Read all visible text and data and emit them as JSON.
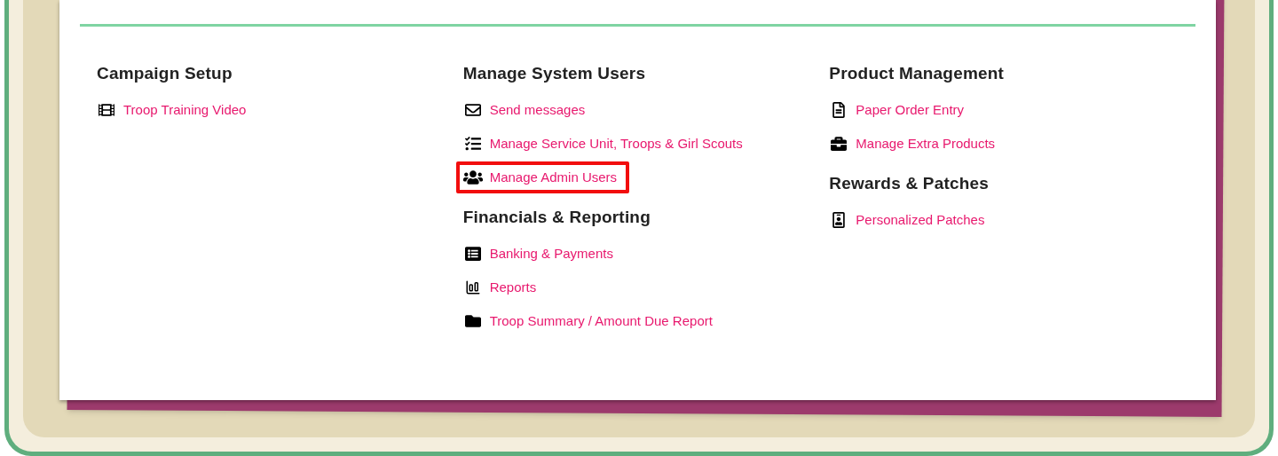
{
  "columns": [
    {
      "sections": [
        {
          "title": "Campaign Setup",
          "links": [
            {
              "label": "Troop Training Video",
              "highlighted": false
            }
          ]
        }
      ]
    },
    {
      "sections": [
        {
          "title": "Manage System Users",
          "links": [
            {
              "label": "Send messages",
              "highlighted": false
            },
            {
              "label": "Manage Service Unit, Troops & Girl Scouts",
              "highlighted": false
            },
            {
              "label": "Manage Admin Users",
              "highlighted": true
            }
          ]
        },
        {
          "title": "Financials & Reporting",
          "links": [
            {
              "label": "Banking & Payments",
              "highlighted": false
            },
            {
              "label": "Reports",
              "highlighted": false
            },
            {
              "label": "Troop Summary / Amount Due Report",
              "highlighted": false
            }
          ]
        }
      ]
    },
    {
      "sections": [
        {
          "title": "Product Management",
          "links": [
            {
              "label": "Paper Order Entry",
              "highlighted": false
            },
            {
              "label": "Manage Extra Products",
              "highlighted": false
            }
          ]
        },
        {
          "title": "Rewards & Patches",
          "links": [
            {
              "label": "Personalized Patches",
              "highlighted": false
            }
          ]
        }
      ]
    }
  ]
}
